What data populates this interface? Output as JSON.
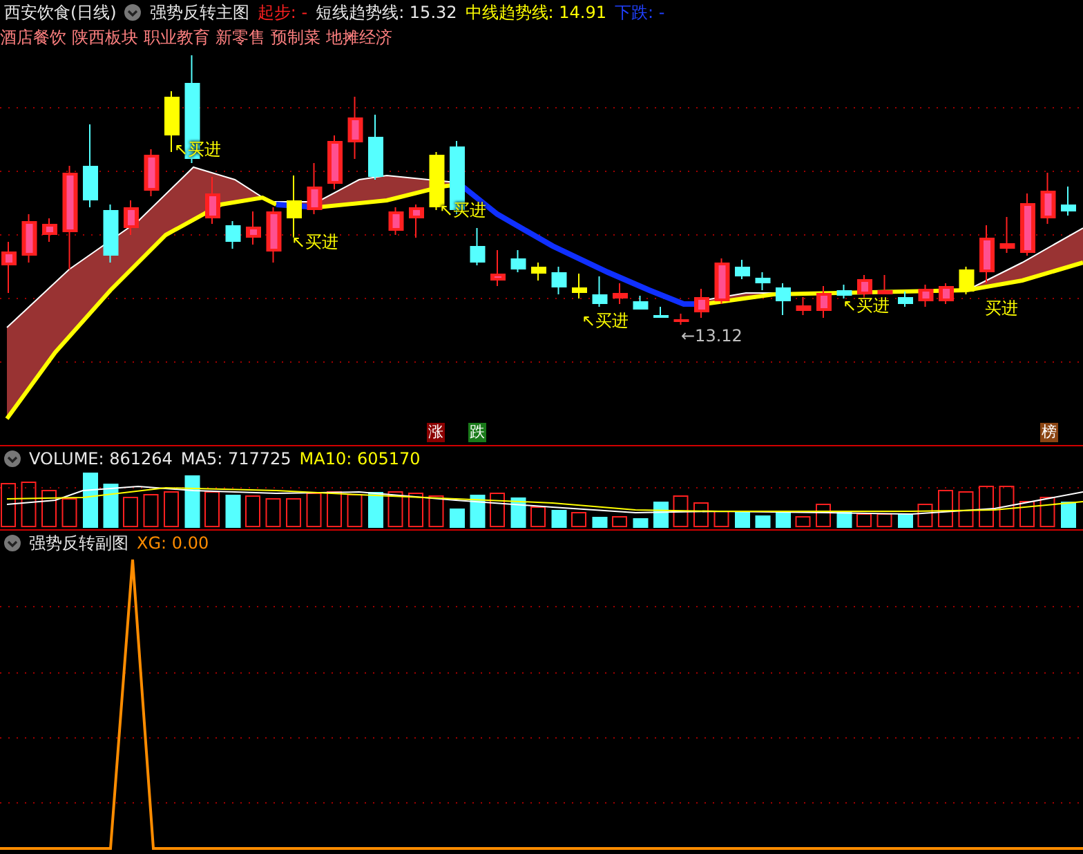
{
  "header": {
    "stock": "西安饮食(日线)",
    "indicator": "强势反转主图",
    "readings": [
      {
        "text": "起步: -",
        "color": "#ff2020"
      },
      {
        "text": "短线趋势线: 15.32",
        "color": "#e8e8e8"
      },
      {
        "text": "中线趋势线: 14.91",
        "color": "#ffff00"
      },
      {
        "text": "下跌: -",
        "color": "#2040ff"
      }
    ]
  },
  "tags": [
    "酒店餐饮",
    "陕西板块",
    "职业教育",
    "新零售",
    "预制菜",
    "地摊经济"
  ],
  "main_chart": {
    "buy_labels": [
      "↖买进",
      "↖买进",
      "↖买进",
      "↖买进",
      "↖买进",
      "买进"
    ],
    "low_label": "←13.12",
    "markers": [
      {
        "text": "涨",
        "color": "#8b0000"
      },
      {
        "text": "跌",
        "color": "#1a7a1a"
      },
      {
        "text": "榜",
        "color": "#8b4513"
      }
    ]
  },
  "volume_panel": {
    "readings": [
      {
        "text": "VOLUME: 861264",
        "color": "#e8e8e8"
      },
      {
        "text": "MA5: 717725",
        "color": "#e8e8e8"
      },
      {
        "text": "MA10: 605170",
        "color": "#ffff00"
      }
    ]
  },
  "sub_panel": {
    "title": "强势反转副图",
    "reading": "XG: 0.00"
  }
}
